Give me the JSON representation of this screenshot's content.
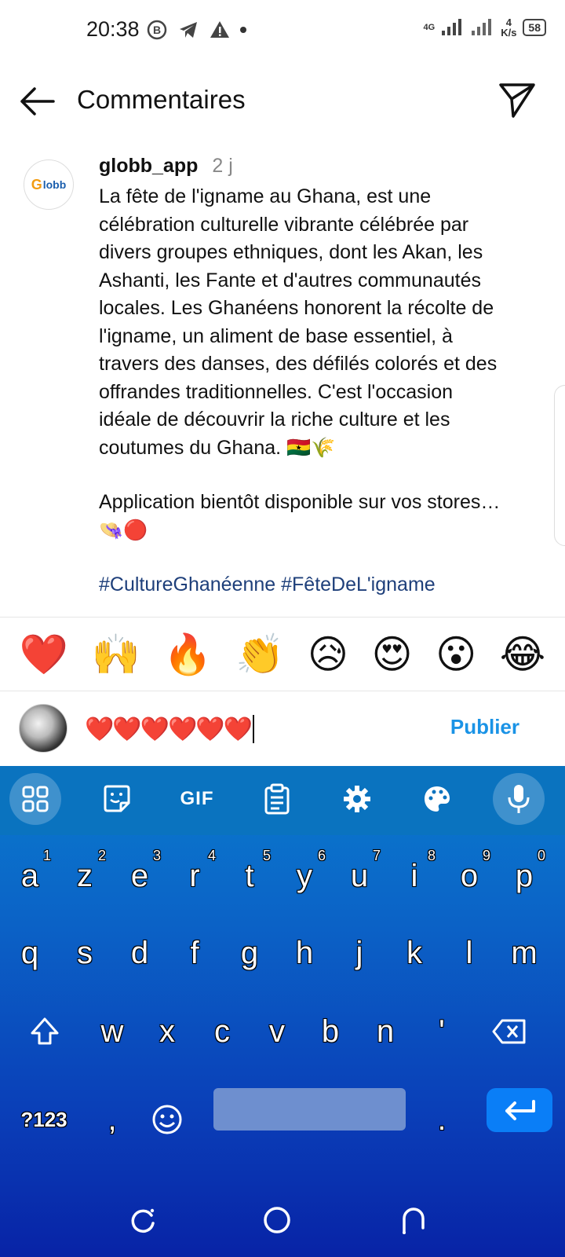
{
  "status_bar": {
    "time": "20:38",
    "network": "4G",
    "speed_value": "4",
    "speed_unit": "K/s",
    "battery": "58"
  },
  "header": {
    "title": "Commentaires"
  },
  "comment": {
    "username": "globb_app",
    "time": "2 j",
    "avatar_text": "lobb",
    "paragraph1": "La fête de l'igname au Ghana, est une célébration culturelle vibrante célébrée par divers groupes ethniques, dont les Akan, les Ashanti, les Fante et d'autres communautés locales. Les Ghanéens honorent la récolte de l'igname, un aliment de base essentiel, à travers des danses, des défilés colorés et des offrandes traditionnelles. C'est l'occasion idéale de découvrir la riche culture et les coutumes du Ghana. 🇬🇭🌾",
    "paragraph2": "Application bientôt disponible sur vos stores…👒🔴",
    "hashtags": "#CultureGhanéenne #FêteDeL'igname"
  },
  "emoji_bar": [
    "❤️",
    "🙌",
    "🔥",
    "👏",
    "😥",
    "😍",
    "😮",
    "😂"
  ],
  "input": {
    "value": "❤️❤️❤️❤️❤️❤️",
    "publish_label": "Publier"
  },
  "keyboard": {
    "toolbar": [
      "apps-icon",
      "sticker-icon",
      "GIF",
      "clipboard-icon",
      "settings-icon",
      "palette-icon",
      "mic-icon"
    ],
    "gif_label": "GIF",
    "row1": [
      "a",
      "z",
      "e",
      "r",
      "t",
      "y",
      "u",
      "i",
      "o",
      "p"
    ],
    "row1_hints": [
      "1",
      "2",
      "3",
      "4",
      "5",
      "6",
      "7",
      "8",
      "9",
      "0"
    ],
    "row2": [
      "q",
      "s",
      "d",
      "f",
      "g",
      "h",
      "j",
      "k",
      "l",
      "m"
    ],
    "row3": [
      "w",
      "x",
      "c",
      "v",
      "b",
      "n",
      "'"
    ],
    "symbols_label": "?123",
    "comma": ",",
    "period": "."
  }
}
